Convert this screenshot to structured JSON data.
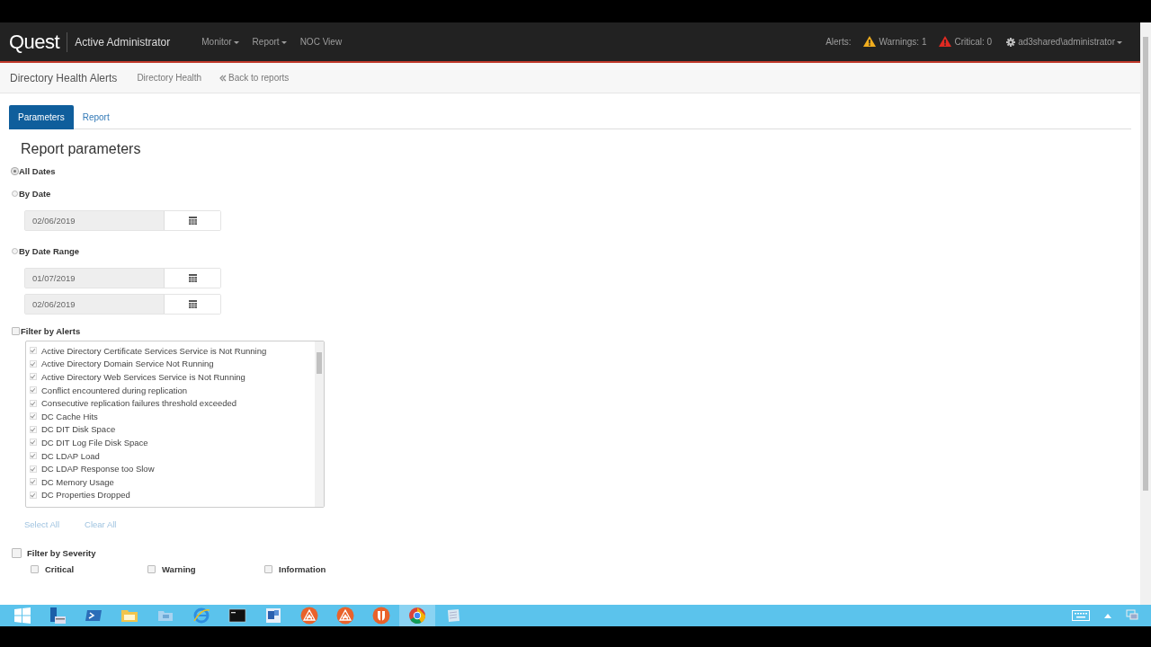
{
  "header": {
    "logo": "Quest",
    "product": "Active Administrator",
    "menu": [
      {
        "label": "Monitor",
        "dropdown": true
      },
      {
        "label": "Report",
        "dropdown": true
      },
      {
        "label": "NOC View",
        "dropdown": false
      }
    ],
    "alerts_label": "Alerts:",
    "warnings": "Warnings: 1",
    "critical": "Critical: 0",
    "user": "ad3shared\\administrator"
  },
  "subheader": {
    "title": "Directory Health Alerts",
    "crumb": "Directory Health",
    "back": "Back to reports"
  },
  "tabs": [
    {
      "label": "Parameters",
      "selected": true
    },
    {
      "label": "Report",
      "selected": false
    }
  ],
  "heading": "Report parameters",
  "date_options": [
    {
      "label": "All Dates",
      "selected": true
    },
    {
      "label": "By Date",
      "selected": false,
      "dates": [
        "02/06/2019"
      ]
    },
    {
      "label": "By Date Range",
      "selected": false,
      "dates": [
        "01/07/2019",
        "02/06/2019"
      ]
    }
  ],
  "filter_alerts": {
    "label": "Filter by Alerts",
    "checked": false,
    "select_all": "Select All",
    "clear_all": "Clear All",
    "items": [
      {
        "label": "Active Directory Certificate Services Service is Not Running",
        "checked": true
      },
      {
        "label": "Active Directory Domain Service Not Running",
        "checked": true
      },
      {
        "label": "Active Directory Web Services Service is Not Running",
        "checked": true
      },
      {
        "label": "Conflict encountered during replication",
        "checked": true
      },
      {
        "label": "Consecutive replication failures threshold exceeded",
        "checked": true
      },
      {
        "label": "DC Cache Hits",
        "checked": true
      },
      {
        "label": "DC DIT Disk Space",
        "checked": true
      },
      {
        "label": "DC DIT Log File Disk Space",
        "checked": true
      },
      {
        "label": "DC LDAP Load",
        "checked": true
      },
      {
        "label": "DC LDAP Response too Slow",
        "checked": true
      },
      {
        "label": "DC Memory Usage",
        "checked": true
      },
      {
        "label": "DC Properties Dropped",
        "checked": true
      }
    ]
  },
  "filter_severity": {
    "label": "Filter by Severity",
    "checked": false,
    "options": [
      {
        "label": "Critical",
        "checked": false
      },
      {
        "label": "Warning",
        "checked": false
      },
      {
        "label": "Information",
        "checked": false
      }
    ]
  }
}
